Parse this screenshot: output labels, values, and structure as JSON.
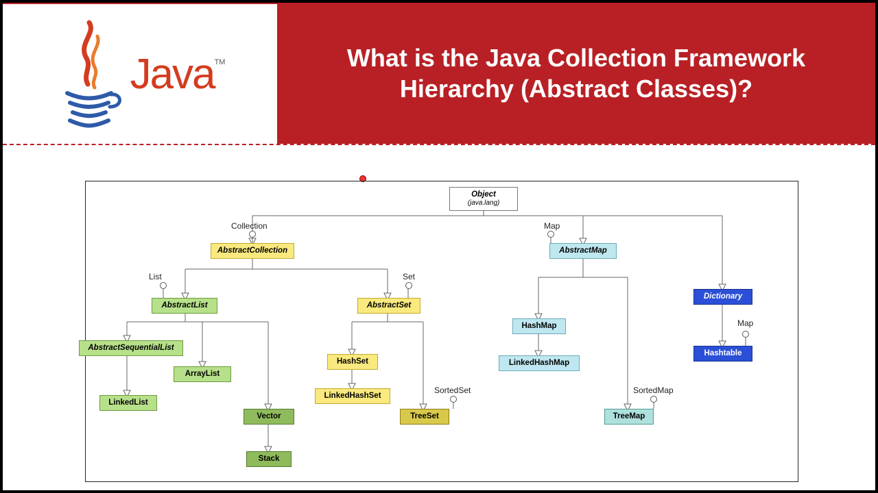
{
  "header": {
    "logo_text": "Java",
    "tm": "TM",
    "title": "What is the Java Collection Framework Hierarchy (Abstract Classes)?"
  },
  "diagram": {
    "root": {
      "name": "Object",
      "pkg": "(java.lang)"
    },
    "interfaces": {
      "collection": "Collection",
      "list": "List",
      "set": "Set",
      "map": "Map",
      "sortedset": "SortedSet",
      "sortedmap": "SortedMap",
      "map2": "Map"
    },
    "nodes": {
      "abstractCollection": "AbstractCollection",
      "abstractList": "AbstractList",
      "abstractSequentialList": "AbstractSequentialList",
      "arrayList": "ArrayList",
      "linkedList": "LinkedList",
      "vector": "Vector",
      "stack": "Stack",
      "abstractSet": "AbstractSet",
      "hashSet": "HashSet",
      "linkedHashSet": "LinkedHashSet",
      "treeSet": "TreeSet",
      "abstractMap": "AbstractMap",
      "hashMap": "HashMap",
      "linkedHashMap": "LinkedHashMap",
      "treeMap": "TreeMap",
      "dictionary": "Dictionary",
      "hashtable": "Hashtable"
    }
  }
}
